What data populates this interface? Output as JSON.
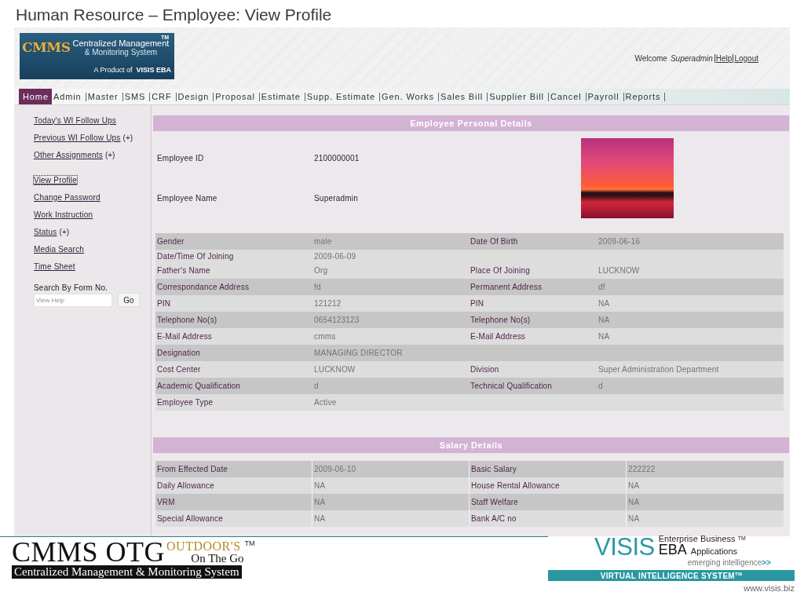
{
  "slide_title": "Human Resource – Employee: View Profile",
  "logo": {
    "trademark": "TM",
    "wordmark": "CMMS",
    "line_1": "Centralized Management",
    "line_2": "& Monitoring System",
    "product_of": "A Product of",
    "brand": "VISIS EBA"
  },
  "welcome": {
    "greeting": "Welcome",
    "user": "Superadmin",
    "links": [
      "Help",
      "Logout"
    ]
  },
  "nav": [
    {
      "label": "Home",
      "selected": true
    },
    {
      "label": "Admin",
      "selected": false
    },
    {
      "label": "Master",
      "selected": false
    },
    {
      "label": "SMS",
      "selected": false
    },
    {
      "label": "CRF",
      "selected": false
    },
    {
      "label": "Design",
      "selected": false
    },
    {
      "label": "Proposal",
      "selected": false
    },
    {
      "label": "Estimate",
      "selected": false
    },
    {
      "label": "Supp. Estimate",
      "selected": false
    },
    {
      "label": "Gen. Works",
      "selected": false
    },
    {
      "label": "Sales Bill",
      "selected": false
    },
    {
      "label": "Supplier Bill",
      "selected": false
    },
    {
      "label": "Cancel",
      "selected": false
    },
    {
      "label": "Payroll",
      "selected": false
    },
    {
      "label": "Reports",
      "selected": false
    }
  ],
  "sidebar": {
    "groups": [
      {
        "items": [
          {
            "label": "Today's WI Follow Ups",
            "selected": false
          },
          {
            "label": "Previous WI Follow Ups",
            "suffix": "(+)",
            "selected": false
          },
          {
            "label": "Other Assignments",
            "suffix": "(+)",
            "selected": false
          }
        ]
      },
      {
        "items": [
          {
            "label": "View Profile",
            "selected": true
          },
          {
            "label": "Change Password",
            "selected": false
          },
          {
            "label": "Work Instruction",
            "selected": false
          },
          {
            "label": "Status",
            "suffix": "(+)",
            "selected": false
          },
          {
            "label": "Media Search",
            "selected": false
          },
          {
            "label": "Time Sheet",
            "selected": false
          }
        ]
      }
    ],
    "search_label": "Search By Form No.",
    "search_field": {
      "placeholder": "View Help"
    },
    "go_button": "Go"
  },
  "personal_details": {
    "title": "Employee Personal Details",
    "fields": [
      {
        "label": "Employee ID",
        "value": "2100000001"
      },
      {
        "label": "Employee Name",
        "value": "Superadmin"
      }
    ],
    "rows": [
      {
        "kind": "shaded",
        "label": "Gender",
        "value": "male",
        "label_2": "Date Of Birth",
        "value_2": "2009-06-16"
      },
      {
        "kind": "compact",
        "label": "Date/Time Of Joining",
        "value": "2009-06-09"
      },
      {
        "kind": "plain",
        "label": "Father's Name",
        "value": "Org",
        "label_2": "Place Of Joining",
        "value_2": "LUCKNOW"
      },
      {
        "kind": "shaded",
        "label": "Correspondance Address",
        "value": "fd",
        "label_2": "Permanent Address",
        "value_2": "df"
      },
      {
        "kind": "plain",
        "label": "PIN",
        "value": "121212",
        "label_2": "PIN",
        "value_2": "NA"
      },
      {
        "kind": "shaded",
        "label": "Telephone No(s)",
        "value": "0654123123",
        "label_2": "Telephone No(s)",
        "value_2": "NA"
      },
      {
        "kind": "plain",
        "label": "E-Mail Address",
        "value": "cmms",
        "label_2": "E-Mail Address",
        "value_2": "NA"
      },
      {
        "kind": "shaded",
        "label": "Designation",
        "value": "MANAGING DIRECTOR"
      },
      {
        "kind": "plain",
        "label": "Cost Center",
        "value": "LUCKNOW",
        "label_2": "Division",
        "value_2": "Super Administration Department"
      },
      {
        "kind": "shaded",
        "label": "Academic Qualification",
        "value": "d",
        "label_2": "Technical Qualification",
        "value_2": "d"
      },
      {
        "kind": "plain",
        "label": "Employee Type",
        "value": "Active"
      }
    ]
  },
  "salary_details": {
    "title": "Salary Details",
    "rows": [
      {
        "kind": "shaded",
        "label": "From Effected Date",
        "value": "2009-06-10",
        "label_2": "Basic Salary",
        "value_2": "222222"
      },
      {
        "kind": "plain",
        "label": "Daily Allowance",
        "value": "NA",
        "label_2": "House Rental Allowance",
        "value_2": "NA"
      },
      {
        "kind": "shaded",
        "label": "VRM",
        "value": "NA",
        "label_2": "Staff Welfare",
        "value_2": "NA"
      },
      {
        "kind": "plain",
        "label": "Special Allowance",
        "value": "NA",
        "label_2": "Bank A/C no",
        "value_2": "NA"
      }
    ]
  },
  "footer": {
    "product": {
      "name": "CMMS OTG",
      "tag": "OUTDOOR'S",
      "trademark": "TM",
      "subtitle": "On The Go",
      "full_name": "Centralized Management & Monitoring System"
    },
    "company": {
      "name": "VISIS",
      "line_1": "Enterprise Business $^{TM}$",
      "short_name": "EBA",
      "line_2": "Applications",
      "tagline": "emerging intelligence",
      "tagline_arrows": ">>",
      "banner": "VIRTUAL INTELLIGENCE SYSTEM$^{TM}$",
      "url": "www.visis.biz"
    }
  }
}
